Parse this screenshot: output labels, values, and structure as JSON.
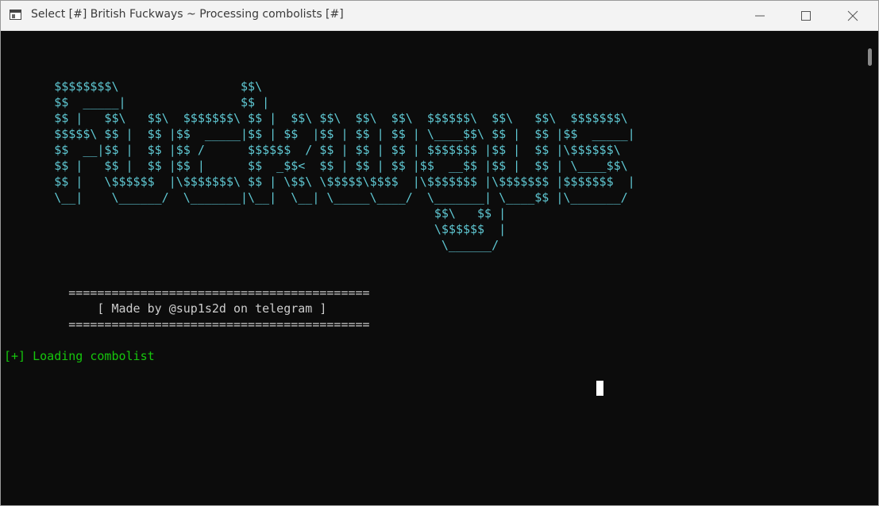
{
  "window": {
    "title": "Select [#] British Fuckways ~ Processing combolists [#]",
    "controls": [
      "minimize-icon",
      "maximize-icon",
      "close-icon"
    ]
  },
  "console": {
    "ascii_art": "       $$$$$$$$\\                 $$\\\n       $$  _____|                $$ |\n       $$ |   $$\\   $$\\  $$$$$$$\\ $$ |  $$\\ $$\\  $$\\  $$\\  $$$$$$\\  $$\\   $$\\  $$$$$$$\\\n       $$$$$\\ $$ |  $$ |$$  _____|$$ | $$  |$$ | $$ | $$ | \\____$$\\ $$ |  $$ |$$  _____|\n       $$  __|$$ |  $$ |$$ /      $$$$$$  / $$ | $$ | $$ | $$$$$$$ |$$ |  $$ |\\$$$$$$\\\n       $$ |   $$ |  $$ |$$ |      $$  _$$<  $$ | $$ | $$ |$$  __$$ |$$ |  $$ | \\____$$\\\n       $$ |   \\$$$$$$  |\\$$$$$$$\\ $$ | \\$$\\ \\$$$$$\\$$$$  |\\$$$$$$$ |\\$$$$$$$ |$$$$$$$  |\n       \\__|    \\______/  \\_______|\\__|  \\__| \\_____\\____/  \\_______| \\____$$ |\\_______/\n                                                            $$\\   $$ |\n                                                            \\$$$$$$  |\n                                                             \\______/",
    "separator": "==========================================",
    "credit": "[ Made by @sup1s2d on telegram ]",
    "status": "[+] Loading combolist"
  },
  "colors": {
    "terminal_bg": "#0c0c0c",
    "ascii_cyan": "#5fc8d3",
    "text_gray": "#cccccc",
    "status_green": "#16c60c"
  }
}
